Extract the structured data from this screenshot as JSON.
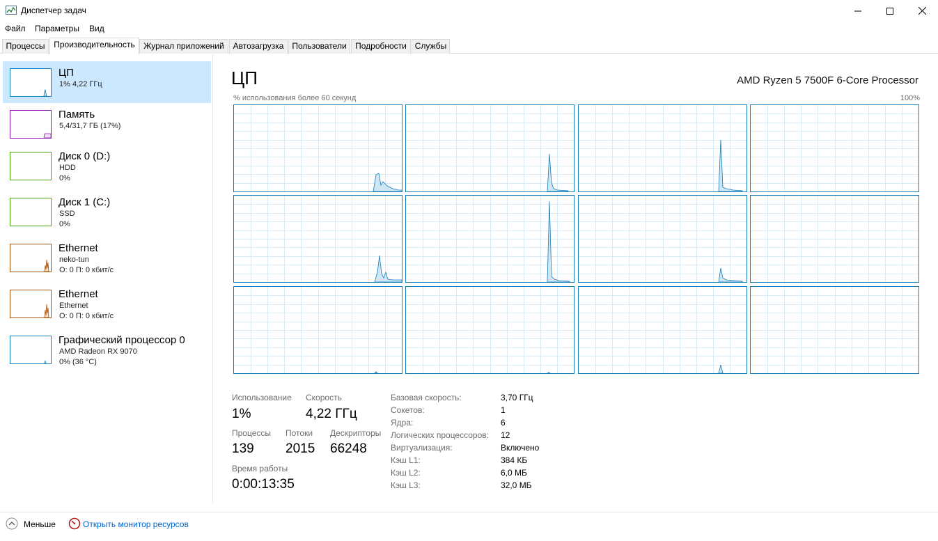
{
  "window": {
    "title": "Диспетчер задач"
  },
  "menu": [
    "Файл",
    "Параметры",
    "Вид"
  ],
  "tabs": [
    {
      "label": "Процессы"
    },
    {
      "label": "Производительность"
    },
    {
      "label": "Журнал приложений"
    },
    {
      "label": "Автозагрузка"
    },
    {
      "label": "Пользователи"
    },
    {
      "label": "Подробности"
    },
    {
      "label": "Службы"
    }
  ],
  "sidebar": {
    "items": [
      {
        "title": "ЦП",
        "line1": "1% 4,22 ГГц",
        "line2": "",
        "line3": "",
        "color": "#117dbb"
      },
      {
        "title": "Память",
        "line1": "5,4/31,7 ГБ (17%)",
        "line2": "",
        "line3": "",
        "color": "#8b12ae"
      },
      {
        "title": "Диск 0 (D:)",
        "line1": "HDD",
        "line2": "0%",
        "line3": "",
        "color": "#4da60c"
      },
      {
        "title": "Диск 1 (C:)",
        "line1": "SSD",
        "line2": "0%",
        "line3": "",
        "color": "#4da60c"
      },
      {
        "title": "Ethernet",
        "line1": "neko-tun",
        "line2": "О: 0 П: 0 кбит/с",
        "line3": "",
        "color": "#a74f01"
      },
      {
        "title": "Ethernet",
        "line1": "Ethernet",
        "line2": "О: 0 П: 0 кбит/с",
        "line3": "",
        "color": "#a74f01"
      },
      {
        "title": "Графический процессор 0",
        "line1": "AMD Radeon RX 9070",
        "line2": "0% (36 °C)",
        "line3": "",
        "color": "#117dbb"
      }
    ]
  },
  "main": {
    "title": "ЦП",
    "cpu_name": "AMD Ryzen 5 7500F 6-Core Processor",
    "graph_caption": "% использования более 60 секунд",
    "graph_max": "100%",
    "graph_color": "#117dbb",
    "graph_fill": "#f1f6fa"
  },
  "stats": {
    "usage_label": "Использование",
    "usage_value": "1%",
    "speed_label": "Скорость",
    "speed_value": "4,22 ГГц",
    "processes_label": "Процессы",
    "processes_value": "139",
    "threads_label": "Потоки",
    "threads_value": "2015",
    "handles_label": "Дескрипторы",
    "handles_value": "66248",
    "uptime_label": "Время работы",
    "uptime_value": "0:00:13:35"
  },
  "info": [
    {
      "label": "Базовая скорость:",
      "value": "3,70 ГГц"
    },
    {
      "label": "Сокетов:",
      "value": "1"
    },
    {
      "label": "Ядра:",
      "value": "6"
    },
    {
      "label": "Логических процессоров:",
      "value": "12"
    },
    {
      "label": "Виртуализация:",
      "value": "Включено"
    },
    {
      "label": "Кэш L1:",
      "value": "384 КБ"
    },
    {
      "label": "Кэш L2:",
      "value": "6,0 МБ"
    },
    {
      "label": "Кэш L3:",
      "value": "32,0 МБ"
    }
  ],
  "footer": {
    "less_label": "Меньше",
    "monitor_label": "Открыть монитор ресурсов",
    "link_color": "#0066cc"
  }
}
